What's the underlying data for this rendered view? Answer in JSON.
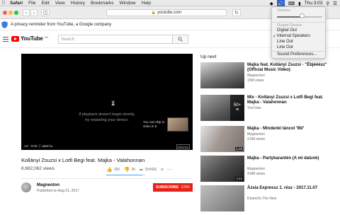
{
  "menubar": {
    "app": "Safari",
    "items": [
      "File",
      "Edit",
      "View",
      "History",
      "Bookmarks",
      "Window",
      "Help"
    ],
    "clock": "Thu 3:03"
  },
  "toolbar": {
    "url": "youtube.com"
  },
  "privacy": {
    "text": "A privacy reminder from YouTube, a Google company"
  },
  "header": {
    "logo_text": "YouTube",
    "logo_country": "HU",
    "search_placeholder": "Search"
  },
  "player": {
    "message": "If playback doesn't begin shortly, try restarting your device.",
    "skip_text": "You can skip to video in 5",
    "ad_info": "Ad · 0:00  ⓘ  adat.hu",
    "ad_logo": "adsense"
  },
  "video": {
    "title": "Kollányi Zsuzsi x Lotfi Begi feat. Majka - Valahonnan",
    "views": "6,682,062 views",
    "likes": "35K",
    "like_ratio": 0.92,
    "dislikes": "3K",
    "share": "SHARE"
  },
  "channel": {
    "name": "Magneoton",
    "published": "Published on Aug 21, 2017",
    "subscribe_label": "SUBSCRIBE",
    "subscriber_count": "228K"
  },
  "upnext": {
    "heading": "Up next",
    "items": [
      {
        "title": "Majka feat. Kollányi Zsuzsi - \"Ébjééész\" (Official Music Video)",
        "channel": "Magneoton",
        "views": "15M views",
        "duration": ""
      },
      {
        "title": "Mix - Kollányi Zsuzsi x Lotfi Begi feat. Majka - Valahonnan",
        "channel": "YouTube",
        "views": "",
        "duration": "",
        "playlist_count": "50+"
      },
      {
        "title": "Majka - Mindenki táncol '90/'",
        "channel": "Magneoton",
        "views": "2.6M views",
        "duration": "5:29"
      },
      {
        "title": "Majka - Partykarantén (A mi dalunk)",
        "channel": "Magneoton",
        "views": "4.8M views",
        "duration": "3:24"
      },
      {
        "title": "Ázsia Expressz 1. rész - 2017.11.07",
        "channel": "DeamOn The New",
        "views": "",
        "duration": ""
      }
    ]
  },
  "volume_menu": {
    "volume_label": "Volume:",
    "volume_level": 0.55,
    "output_label": "Output Device:",
    "devices": [
      "Digital Out",
      "Internal Speakers",
      "Line Out",
      "Line Out"
    ],
    "selected_device": "Internal Speakers",
    "preferences": "Sound Preferences..."
  }
}
